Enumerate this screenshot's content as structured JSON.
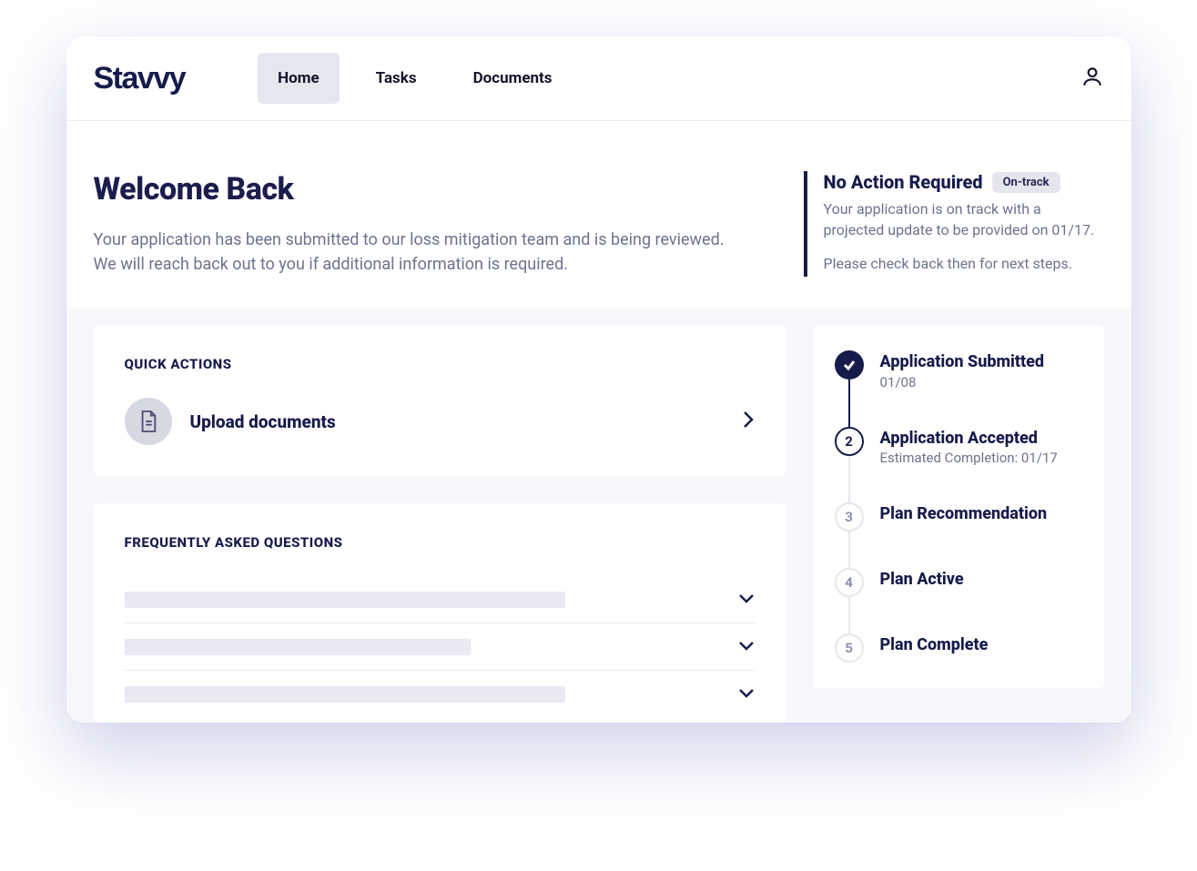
{
  "brand": {
    "name": "Stavvy"
  },
  "nav": {
    "items": [
      {
        "label": "Home",
        "active": true
      },
      {
        "label": "Tasks",
        "active": false
      },
      {
        "label": "Documents",
        "active": false
      }
    ]
  },
  "hero": {
    "title": "Welcome Back",
    "subtitle_line1": "Your application has been submitted to our loss mitigation team and is being reviewed.",
    "subtitle_line2": "We will reach back out to you if additional information is required."
  },
  "status": {
    "title": "No Action Required",
    "badge": "On-track",
    "line1": "Your application is on track with a projected update to be provided on 01/17.",
    "line2": "Please check back then for next steps."
  },
  "quick_actions": {
    "heading": "QUICK ACTIONS",
    "items": [
      {
        "label": "Upload documents"
      }
    ]
  },
  "faq": {
    "heading": "FREQUENTLY ASKED QUESTIONS",
    "count": 3
  },
  "progress": {
    "steps": [
      {
        "title": "Application Submitted",
        "sub": "01/08",
        "state": "done"
      },
      {
        "title": "Application Accepted",
        "sub": "Estimated Completion: 01/17",
        "state": "active",
        "num": "2"
      },
      {
        "title": "Plan Recommendation",
        "sub": "",
        "state": "pending",
        "num": "3"
      },
      {
        "title": "Plan Active",
        "sub": "",
        "state": "pending",
        "num": "4"
      },
      {
        "title": "Plan Complete",
        "sub": "",
        "state": "pending",
        "num": "5"
      }
    ]
  }
}
